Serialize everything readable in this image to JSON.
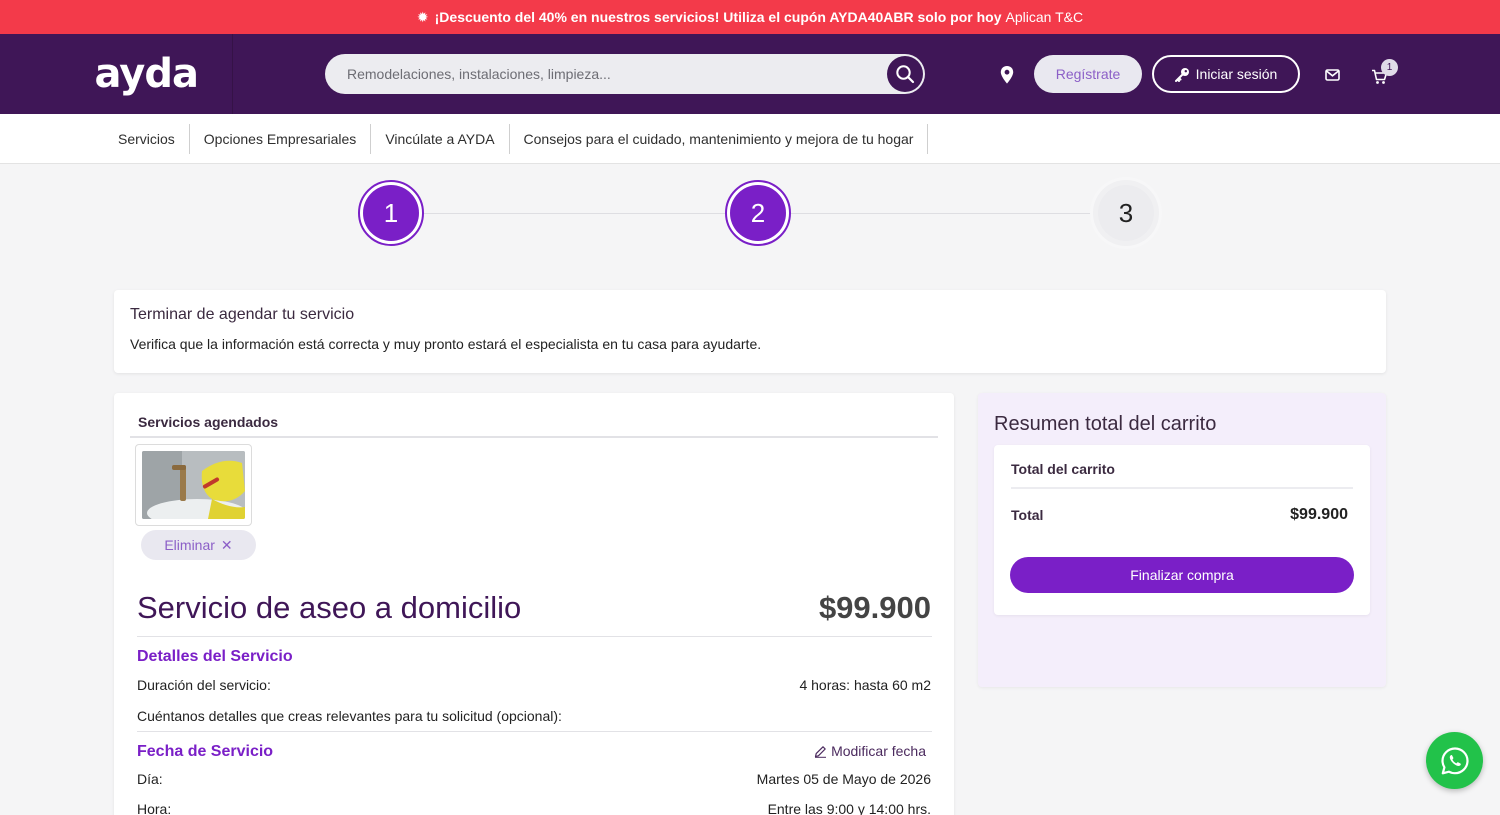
{
  "promo": {
    "bold_text": "¡Descuento del 40% en nuestros servicios! Utiliza el cupón AYDA40ABR solo por hoy",
    "normal_text": "Aplican T&C",
    "icon": "gear-icon"
  },
  "header": {
    "logo": "ayda",
    "search_placeholder": "Remodelaciones, instalaciones, limpieza...",
    "register_label": "Regístrate",
    "login_label": "Iniciar sesión",
    "cart_count": "1"
  },
  "nav": {
    "items": [
      "Servicios",
      "Opciones Empresariales",
      "Vincúlate a AYDA",
      "Consejos para el cuidado, mantenimiento y mejora de tu hogar"
    ]
  },
  "stepper": {
    "steps": [
      "1",
      "2",
      "3"
    ],
    "completed": 2
  },
  "info": {
    "title": "Terminar de agendar tu servicio",
    "text": "Verifica que la información está correcta y muy pronto estará el especialista en tu casa para ayudarte."
  },
  "services": {
    "heading": "Servicios agendados",
    "remove_label": "Eliminar",
    "title": "Servicio de aseo a domicilio",
    "price": "$99.900",
    "details_title": "Detalles del Servicio",
    "duration_label": "Duración del servicio:",
    "duration_value": "4 horas: hasta 60 m2",
    "notes_label": "Cuéntanos detalles que creas relevantes para tu solicitud (opcional):",
    "date_title": "Fecha de Servicio",
    "modify_label": "Modificar fecha",
    "day_label": "Día:",
    "day_value": "Martes 05 de Mayo de 2026",
    "hour_label": "Hora:",
    "hour_value": "Entre las 9:00 y 14:00 hrs."
  },
  "summary": {
    "title": "Resumen total del carrito",
    "subtitle": "Total del carrito",
    "total_label": "Total",
    "total_value": "$99.900",
    "checkout_label": "Finalizar compra"
  },
  "colors": {
    "promo_bg": "#f33a4a",
    "header_bg": "#3f1657",
    "accent": "#7a1fc7",
    "whatsapp": "#22c24a"
  }
}
